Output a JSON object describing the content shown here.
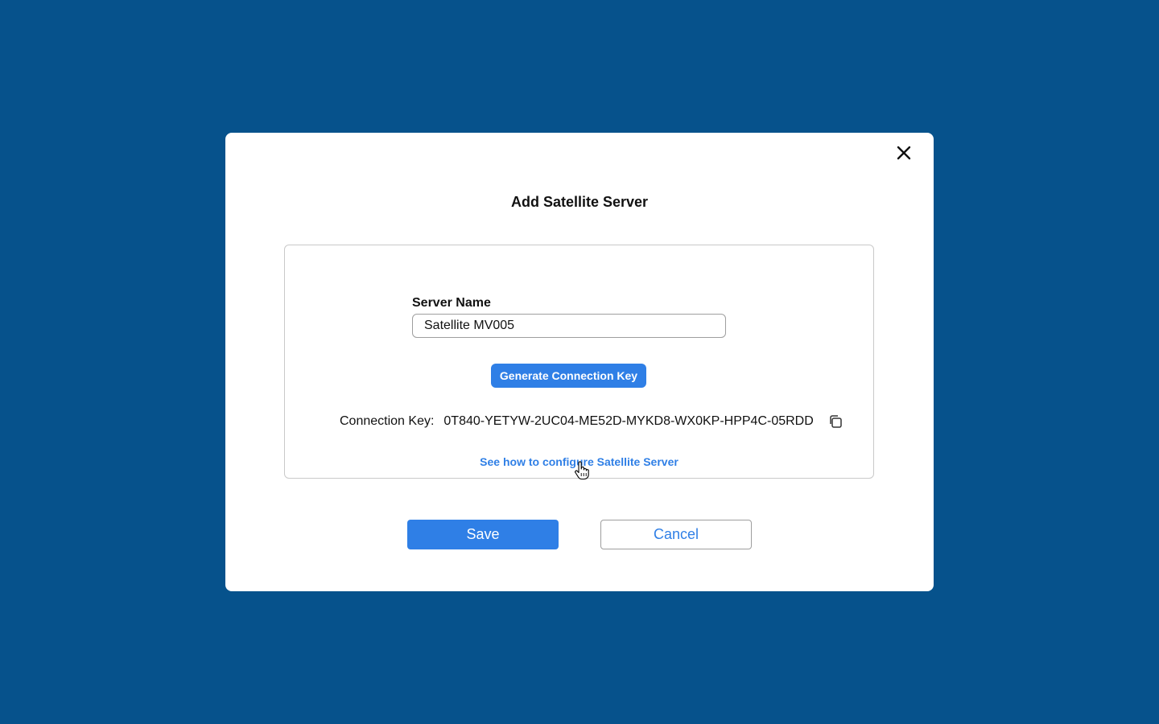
{
  "dialog": {
    "title": "Add Satellite Server",
    "close_icon": "close-icon"
  },
  "form": {
    "server_name_label": "Server Name",
    "server_name_value": "Satellite MV005",
    "generate_button_label": "Generate Connection Key",
    "connection_key_label": "Connection Key:",
    "connection_key_value": "0T840-YETYW-2UC04-ME52D-MYKD8-WX0KP-HPP4C-05RDD",
    "copy_icon": "copy-icon",
    "help_link_text": "See how to configure Satellite Server"
  },
  "actions": {
    "save_label": "Save",
    "cancel_label": "Cancel"
  },
  "colors": {
    "background": "#06528c",
    "accent": "#2f7fe6",
    "dialog": "#ffffff"
  }
}
